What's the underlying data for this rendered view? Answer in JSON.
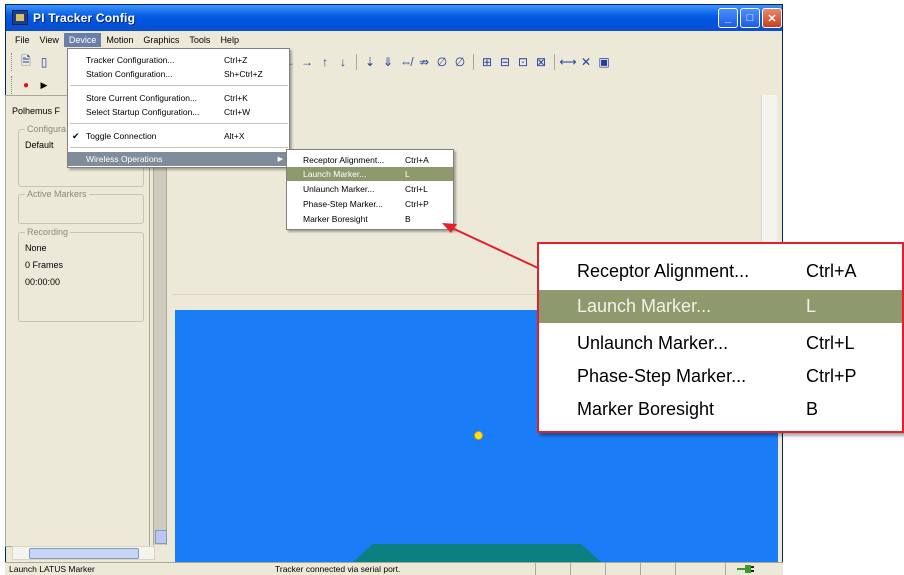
{
  "window": {
    "title": "PI Tracker Config",
    "controls": [
      "_",
      "□",
      "✕"
    ]
  },
  "menubar": [
    "File",
    "View",
    "Device",
    "Motion",
    "Graphics",
    "Tools",
    "Help"
  ],
  "device_menu": {
    "items": [
      {
        "label": "Tracker Configuration...",
        "shortcut": "Ctrl+Z"
      },
      {
        "label": "Station Configuration...",
        "shortcut": "Sh+Ctrl+Z"
      },
      {
        "label": "Store Current Configuration...",
        "shortcut": "Ctrl+K"
      },
      {
        "label": "Select Startup Configuration...",
        "shortcut": "Ctrl+W"
      },
      {
        "label": "Toggle Connection",
        "shortcut": "Alt+X",
        "checked": "✔"
      },
      {
        "label": "Wireless Operations",
        "submenu_arrow": "▶"
      }
    ]
  },
  "wireless_submenu": {
    "items": [
      {
        "label": "Receptor Alignment...",
        "shortcut": "Ctrl+A"
      },
      {
        "label": "Launch Marker...",
        "shortcut": "L"
      },
      {
        "label": "Unlaunch Marker...",
        "shortcut": "Ctrl+L"
      },
      {
        "label": "Phase-Step Marker...",
        "shortcut": "Ctrl+P"
      },
      {
        "label": "Marker Boresight",
        "shortcut": "B"
      }
    ]
  },
  "left_panel": {
    "title": "Polhemus F",
    "configuration": {
      "label": "Configura",
      "value": "Default"
    },
    "active_markers": {
      "label": "Active Markers"
    },
    "recording": {
      "label": "Recording",
      "mode": "None",
      "frames": "0 Frames",
      "time": "00:00:00"
    }
  },
  "status": {
    "left": "Launch LATUS Marker",
    "middle": "Tracker connected via serial port."
  },
  "toolbar_glyphs": [
    "⊖",
    "←",
    "→",
    "↑",
    "↓",
    "⇣",
    "⇓",
    "⇎",
    "⇏",
    "∅",
    "∅",
    "⊞",
    "⊟",
    "⊡",
    "⊠",
    "⟷",
    "✕",
    "▣"
  ],
  "colors": {
    "viewport": "#1a7cf7",
    "highlight": "#8e9a6e",
    "callout_border": "#e0202a"
  }
}
